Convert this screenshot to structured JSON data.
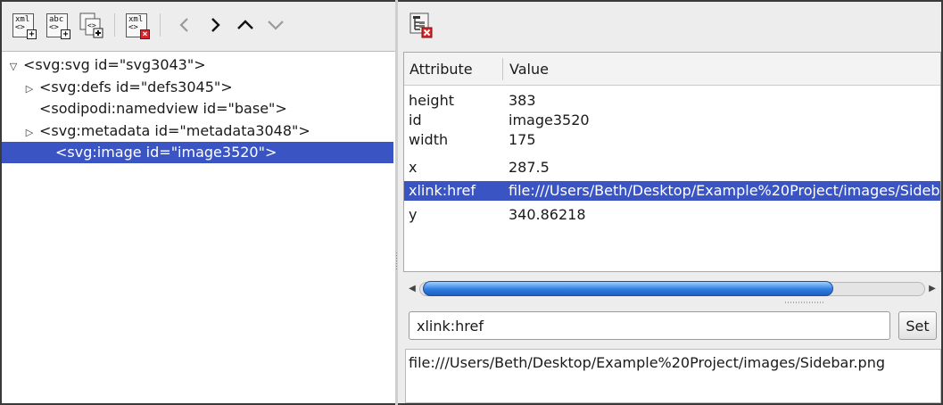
{
  "toolbar": {
    "new_element_icon_text": "xml",
    "new_text_icon_text": "abc",
    "delete_icon_text": "xml"
  },
  "tree": {
    "nodes": [
      {
        "label": "<svg:svg id=\"svg3043\">",
        "expander": "▽"
      },
      {
        "label": "<svg:defs id=\"defs3045\">",
        "expander": "▷"
      },
      {
        "label": "<sodipodi:namedview id=\"base\">",
        "expander": ""
      },
      {
        "label": "<svg:metadata id=\"metadata3048\">",
        "expander": "▷"
      },
      {
        "label": "<svg:image id=\"image3520\">",
        "expander": ""
      }
    ]
  },
  "attributes": {
    "header_attribute": "Attribute",
    "header_value": "Value",
    "rows": [
      {
        "name": "height",
        "value": "383"
      },
      {
        "name": "id",
        "value": "image3520"
      },
      {
        "name": "width",
        "value": "175"
      },
      {
        "name": "x",
        "value": "287.5"
      },
      {
        "name": "xlink:href",
        "value": "file:///Users/Beth/Desktop/Example%20Project/images/Sidebar.png"
      },
      {
        "name": "y",
        "value": "340.86218"
      }
    ]
  },
  "editor": {
    "attribute_name": "xlink:href",
    "set_label": "Set",
    "attribute_value": "file:///Users/Beth/Desktop/Example%20Project/images/Sidebar.png"
  },
  "colors": {
    "selection": "#3a54c4",
    "scroll_thumb": "#2f7de0",
    "delete_badge": "#d7252c"
  }
}
